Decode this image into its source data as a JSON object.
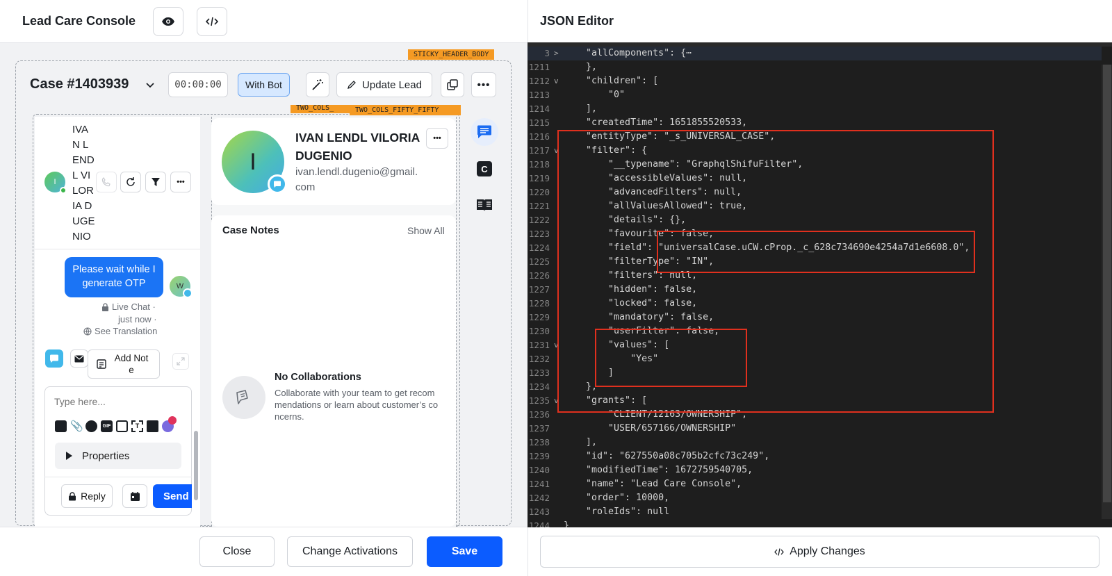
{
  "left": {
    "app_title": "Lead Care Console",
    "tags": {
      "sticky": "STICKY_HEADER_BODY",
      "two_cols_a": "TWO_COLS_",
      "two_cols_b": "TWO_COLS_FIFTY_FIFTY"
    },
    "case_title": "Case #1403939",
    "timer": "00:00:00",
    "with_bot": "With Bot",
    "update_lead": "Update Lead",
    "contact_name_wrapped": [
      "IVA",
      "N L",
      "END",
      "L VI",
      "LOR",
      "IA D",
      "UGE",
      "NIO"
    ],
    "avatar_letter_small": "I",
    "chat_message": "Please wait while I generate OTP",
    "chat_avatar": "W",
    "meta": {
      "channel": "Live Chat ·",
      "time": "just now ·",
      "translation": "See Translation"
    },
    "add_note": "Add Note",
    "type_placeholder": "Type here...",
    "properties": "Properties",
    "reply": "Reply",
    "send": "Send",
    "profile": {
      "letter": "I",
      "name": "IVAN LENDL VILORIA DUGENIO",
      "email": "ivan.lendl.dugenio@gmail.com"
    },
    "case_notes": {
      "title": "Case Notes",
      "show_all": "Show All"
    },
    "collab": {
      "title": "No Collaborations",
      "desc": "Collaborate with your team to get recommendations or learn about customer’s concerns."
    },
    "footer": {
      "close": "Close",
      "change_activations": "Change Activations",
      "save": "Save"
    },
    "colors": {
      "primary": "#0b5cff",
      "tag": "#f59a23",
      "bot_bg": "#d6e8ff"
    }
  },
  "right": {
    "title": "JSON Editor",
    "apply": "Apply Changes",
    "lines": [
      {
        "n": "3",
        "fold": ">",
        "code": "    \"allComponents\": {⋯"
      },
      {
        "n": "1211",
        "fold": "",
        "code": "    },"
      },
      {
        "n": "1212",
        "fold": "v",
        "code": "    \"children\": ["
      },
      {
        "n": "1213",
        "fold": "",
        "code": "        \"0\""
      },
      {
        "n": "1214",
        "fold": "",
        "code": "    ],"
      },
      {
        "n": "1215",
        "fold": "",
        "code": "    \"createdTime\": 1651855520533,"
      },
      {
        "n": "1216",
        "fold": "",
        "code": "    \"entityType\": \"_s_UNIVERSAL_CASE\","
      },
      {
        "n": "1217",
        "fold": "v",
        "code": "    \"filter\": {"
      },
      {
        "n": "1218",
        "fold": "",
        "code": "        \"__typename\": \"GraphqlShifuFilter\","
      },
      {
        "n": "1219",
        "fold": "",
        "code": "        \"accessibleValues\": null,"
      },
      {
        "n": "1220",
        "fold": "",
        "code": "        \"advancedFilters\": null,"
      },
      {
        "n": "1221",
        "fold": "",
        "code": "        \"allValuesAllowed\": true,"
      },
      {
        "n": "1222",
        "fold": "",
        "code": "        \"details\": {},"
      },
      {
        "n": "1223",
        "fold": "",
        "code": "        \"favourite\": false,"
      },
      {
        "n": "1224",
        "fold": "",
        "code": "        \"field\": \"universalCase.uCW.cProp._c_628c734690e4254a7d1e6608.0\","
      },
      {
        "n": "1225",
        "fold": "",
        "code": "        \"filterType\": \"IN\","
      },
      {
        "n": "1226",
        "fold": "",
        "code": "        \"filters\": null,"
      },
      {
        "n": "1227",
        "fold": "",
        "code": "        \"hidden\": false,"
      },
      {
        "n": "1228",
        "fold": "",
        "code": "        \"locked\": false,"
      },
      {
        "n": "1229",
        "fold": "",
        "code": "        \"mandatory\": false,"
      },
      {
        "n": "1230",
        "fold": "",
        "code": "        \"userFilter\": false,"
      },
      {
        "n": "1231",
        "fold": "v",
        "code": "        \"values\": ["
      },
      {
        "n": "1232",
        "fold": "",
        "code": "            \"Yes\""
      },
      {
        "n": "1233",
        "fold": "",
        "code": "        ]"
      },
      {
        "n": "1234",
        "fold": "",
        "code": "    },"
      },
      {
        "n": "1235",
        "fold": "v",
        "code": "    \"grants\": ["
      },
      {
        "n": "1236",
        "fold": "",
        "code": "        \"CLIENT/12163/OWNERSHIP\","
      },
      {
        "n": "1237",
        "fold": "",
        "code": "        \"USER/657166/OWNERSHIP\""
      },
      {
        "n": "1238",
        "fold": "",
        "code": "    ],"
      },
      {
        "n": "1239",
        "fold": "",
        "code": "    \"id\": \"627550a08c705b2cfc73c249\","
      },
      {
        "n": "1240",
        "fold": "",
        "code": "    \"modifiedTime\": 1672759540705,"
      },
      {
        "n": "1241",
        "fold": "",
        "code": "    \"name\": \"Lead Care Console\","
      },
      {
        "n": "1242",
        "fold": "",
        "code": "    \"order\": 10000,"
      },
      {
        "n": "1243",
        "fold": "",
        "code": "    \"roleIds\": null"
      },
      {
        "n": "1244",
        "fold": "",
        "code": "}"
      }
    ]
  }
}
